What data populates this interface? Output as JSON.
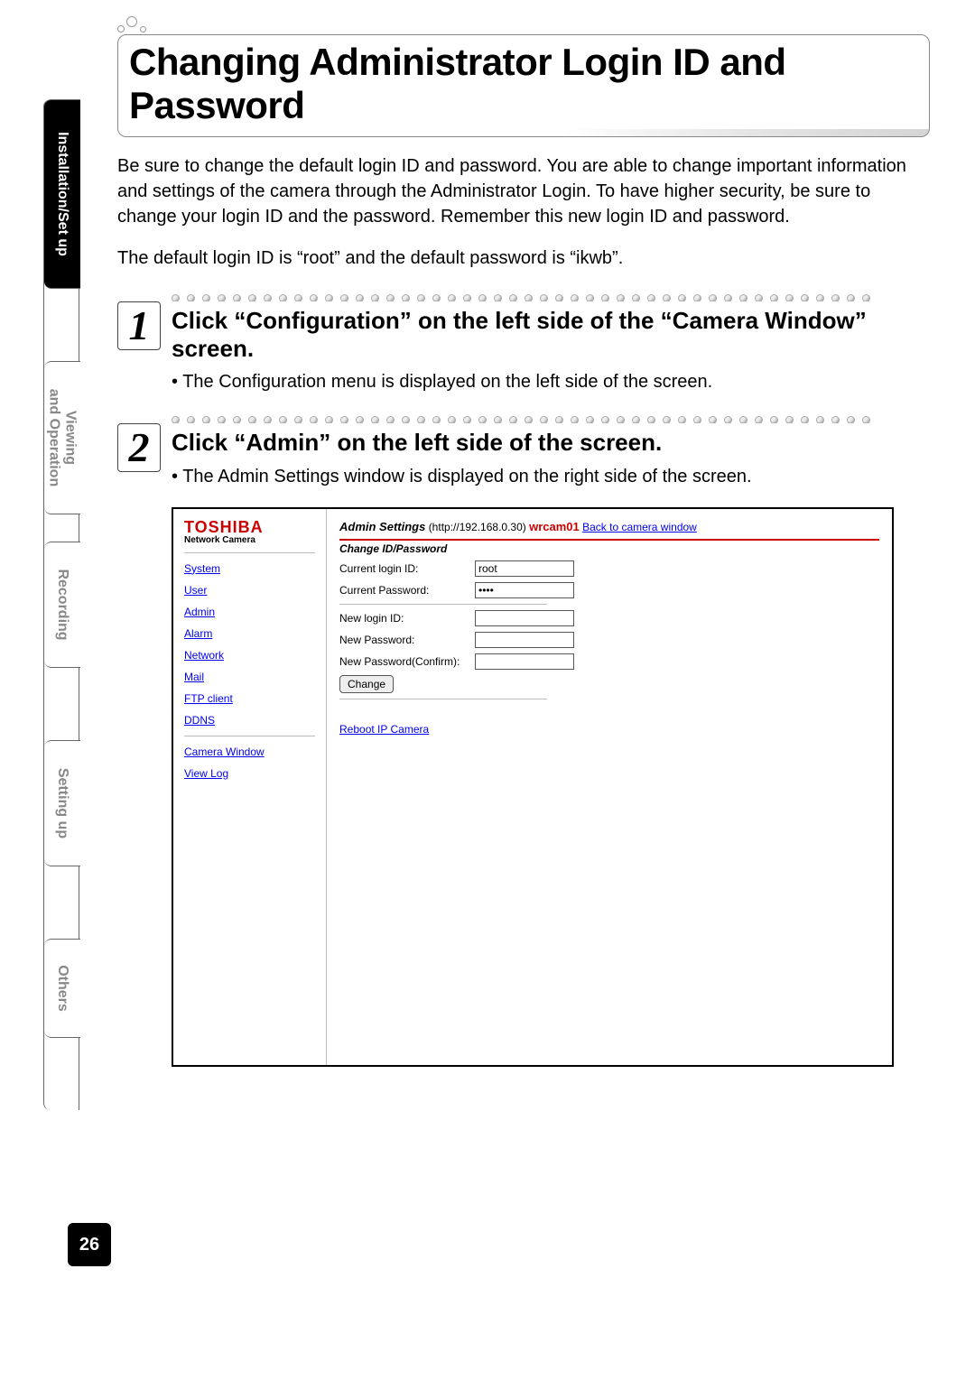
{
  "tabs": {
    "installation": "Installation/Set up",
    "viewing_l1": "Viewing",
    "viewing_l2": "and Operation",
    "recording": "Recording",
    "setting": "Setting up",
    "others": "Others"
  },
  "page_number": "26",
  "title": "Changing Administrator Login ID and Password",
  "intro": {
    "p1": "Be sure to change the default login ID and password. You are able to change important information and settings of the camera through the Administrator Login. To have higher security, be sure to change your login ID and the password. Remember this new login ID and password.",
    "p2": "The default login ID is “root” and the default password is “ikwb”."
  },
  "steps": {
    "s1": {
      "num": "1",
      "title": "Click “Configuration” on the left side of the “Camera Window” screen.",
      "bullet": "• The Configuration menu is displayed on the left side of the screen."
    },
    "s2": {
      "num": "2",
      "title": "Click “Admin” on the left side of the screen.",
      "bullet": "• The Admin Settings window is displayed on the right side of the screen."
    }
  },
  "shot": {
    "brand": "TOSHIBA",
    "brand_sub": "Network Camera",
    "nav": {
      "system": "System",
      "user": "User",
      "admin": "Admin",
      "alarm": "Alarm",
      "network": "Network",
      "mail": "Mail",
      "ftp": "FTP client",
      "ddns": "DDNS",
      "camera_window": "Camera Window",
      "view_log": "View Log"
    },
    "header": {
      "title": "Admin Settings",
      "url": "(http://192.168.0.30)",
      "cam": "wrcam01",
      "back": "Back to camera window"
    },
    "section": "Change ID/Password",
    "fields": {
      "cur_id_label": "Current login ID:",
      "cur_id_value": "root",
      "cur_pw_label": "Current Password:",
      "cur_pw_value": "••••",
      "new_id_label": "New login ID:",
      "new_pw_label": "New Password:",
      "new_pw2_label": "New Password(Confirm):",
      "change_btn": "Change"
    },
    "reboot": "Reboot IP Camera"
  }
}
